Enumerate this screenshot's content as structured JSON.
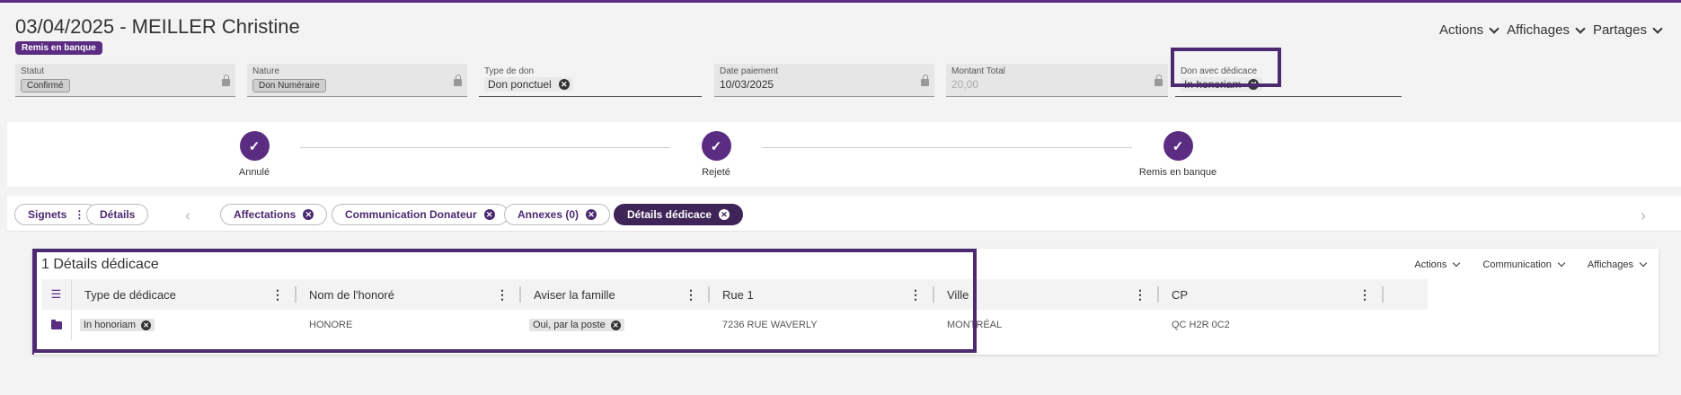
{
  "header": {
    "title": "03/04/2025 - MEILLER Christine",
    "status_badge": "Remis en banque",
    "actions": [
      {
        "label": "Actions"
      },
      {
        "label": "Affichages"
      },
      {
        "label": "Partages"
      }
    ]
  },
  "fields": {
    "statut": {
      "label": "Statut",
      "value": "Confirmé"
    },
    "nature": {
      "label": "Nature",
      "value": "Don Numéraire"
    },
    "type_don": {
      "label": "Type de don",
      "value": "Don ponctuel"
    },
    "date_paiement": {
      "label": "Date paiement",
      "value": "10/03/2025"
    },
    "montant_total": {
      "label": "Montant Total",
      "value": "20,00"
    },
    "don_dedicace": {
      "label": "Don avec dédicace",
      "value": "In honoriam"
    }
  },
  "steps": [
    {
      "label": "Annulé"
    },
    {
      "label": "Rejeté"
    },
    {
      "label": "Remis en banque"
    }
  ],
  "tabs": {
    "signets": "Signets",
    "details": "Détails",
    "affectations": "Affectations",
    "communication": "Communication Donateur",
    "annexes": "Annexes (0)",
    "details_dedicace": "Détails dédicace"
  },
  "panel": {
    "title": "1 Détails dédicace",
    "actions": [
      "Actions",
      "Communication",
      "Affichages"
    ],
    "columns": [
      "Type de dédicace",
      "Nom de l'honoré",
      "Aviser la famille",
      "Rue 1",
      "Ville",
      "CP"
    ],
    "row": {
      "type_dedicace": "In honoriam",
      "nom_honore": "HONORE",
      "aviser_famille": "Oui, par la poste",
      "rue1": "7236 RUE WAVERLY",
      "ville": "MONTRÉAL",
      "cp": "QC H2R 0C2"
    }
  },
  "colors": {
    "accent": "#5b2d82",
    "active_tab": "#3f2557",
    "highlight_border": "#4b2a70"
  }
}
